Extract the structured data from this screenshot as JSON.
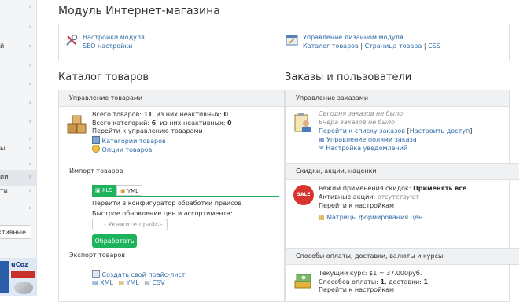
{
  "sidebar": {
    "items": [
      {
        "label": ""
      },
      {
        "label": ""
      },
      {
        "label": "й"
      },
      {
        "label": ""
      },
      {
        "label": ""
      },
      {
        "label": ""
      },
      {
        "label": ""
      },
      {
        "label": ""
      },
      {
        "label": ""
      },
      {
        "label": "ы"
      },
      {
        "label": ""
      },
      {
        "label": "ии"
      },
      {
        "label": "ти"
      },
      {
        "label": ""
      }
    ],
    "button_label": "ктивные",
    "ad_text": "uCoz"
  },
  "page_title": "Модуль Интернет-магазина",
  "module": {
    "settings_link": "Настройки модуля",
    "seo_link": "SEO настройки",
    "design_link": "Управление дизайном модуля",
    "catalog_page_link": "Каталог товаров",
    "product_page_link": "Страница товара",
    "css_link": "CSS",
    "sep": "|"
  },
  "catalog": {
    "title": "Каталог товаров",
    "manage_header": "Управление товарами",
    "products_prefix": "Всего товаров:",
    "products_count": "11",
    "products_mid": ", из них неактивных:",
    "products_inactive": "0",
    "categories_prefix": "Всего категорий:",
    "categories_count": "6",
    "categories_mid": ", из них неактивных:",
    "categories_inactive": "0",
    "goto_manage_link": "Перейти к управлению товарами",
    "categories_link": "Категории товаров",
    "options_link": "Опции товаров",
    "import_title": "Импорт товаров",
    "tab_xls": "XLS",
    "tab_yml": "YML",
    "configurator_link": "Перейти в конфигуратор обработки прайсов",
    "quick_update_label": "Быстрое обновление цен и ассортимента:",
    "select_placeholder": "- Укажите прайс -",
    "process_button": "Обработать",
    "export_title": "Экспорт товаров",
    "create_pricelist_link": "Создать свой прайс-лист",
    "export_xml": "XML",
    "export_yml": "YML",
    "export_csv": "CSV"
  },
  "orders": {
    "title": "Заказы и пользователи",
    "manage_header": "Управление заказами",
    "today": "Сегодня заказов не было",
    "yesterday": "Вчера заказов не было",
    "goto_orders_link": "Перейти к списку заказов",
    "configure_access_link": "Настроить доступ",
    "order_fields_link": "Управление полями заказа",
    "notifications_link": "Настройка уведомлений",
    "discounts_header": "Скидки, акции, наценки",
    "discount_mode_label": "Режим применения скидок:",
    "discount_mode_value": "Применять все",
    "active_promos_label": "Активные акции:",
    "active_promos_value": "отсутствуют",
    "goto_settings_link": "Перейти к настройкам",
    "matrix_link": "Матрицы формирования цен",
    "payment_header": "Способы оплаты, доставки, валюты и курсы",
    "rate_label": "Текущий курс:",
    "rate_value": "$1 = 37.000руб.",
    "payment_label": "Способов оплаты:",
    "payment_count": "1",
    "delivery_label": ", доставки:",
    "delivery_count": "1",
    "goto_settings_link2": "Перейти к настройкам",
    "sale_badge": "SALE"
  },
  "colors": {
    "link": "#2f6aa6",
    "accent_green": "#1db35c",
    "panel_header_bg": "#f0f1f3"
  }
}
